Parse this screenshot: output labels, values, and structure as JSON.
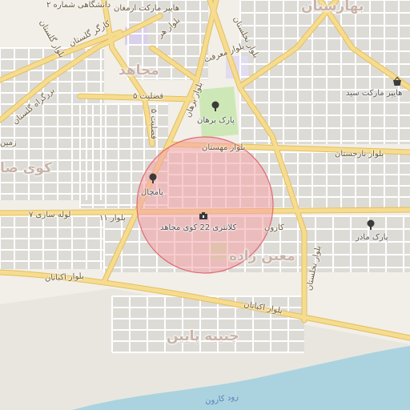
{
  "colors": {
    "background": "#f2efe9",
    "block": "#dddbd6",
    "block_outline": "#ffffff",
    "major_road": "#f6dc8f",
    "major_road_casing": "#e3bf61",
    "minor_road": "#ffffff",
    "park": "#cde8b6",
    "water": "#aad3df",
    "sand": "#e9e6e0",
    "highlight_circle_fill": "#f4a3a8",
    "highlight_circle_stroke": "#e06a73"
  },
  "highlight_circle": {
    "shown": true
  },
  "districts": {
    "baharestan": "بهارستان",
    "mojahed": "مجاهد",
    "koye_sa": "کوی صا",
    "moin_zadeh": "معین زاده",
    "chenibeh_paeen": "چنیبه پایین"
  },
  "roads": {
    "golestan_university": "دانشگاهی شماره ۲",
    "hyper_armaghan": "هایپر مارکت ارمغان",
    "golestan_tollgate": "کارگر گلستان",
    "bolvar_golestan": "بلوار گلستان",
    "bolvar_hor": "بلوار هر",
    "bolvar_marafat": "بلوار معرفت",
    "bolvar_nakhlestan_top": "بلوار نخلستان",
    "bolvar_nakhlestan_bottom": "بلوار نخلستان",
    "zargaregolestan": "بزرگراه گلستان",
    "fazilat5": "فضلیت ۵",
    "bolvar_borhan": "بلوار برهان",
    "bolvar_mahestan": "بلوار مهستان",
    "bolvar_narjestan": "بلوار نارجستان",
    "loleh_sazi": "لوله سازی ۷",
    "bolvar11": "بلوار ۱۱",
    "karun": "کارون",
    "bolvar_ekbatan_left": "بلوار اکباتان",
    "bolvar_ekbatan_right": "بلوار اکباتان",
    "zamin": "زمین",
    "karun_river": "رود کارون"
  },
  "pois": {
    "park_borhan": "پارک برهان",
    "hypermarket_saeed": "هایپر مارکت سید",
    "pamchal": "پامچال",
    "kalantari": "کلانتری 22 کوی مجاهد",
    "park_madar": "پارک مادر"
  },
  "icons": {
    "park_borhan": "tree-icon",
    "park_madar": "tree-icon",
    "pamchal": "tree-icon",
    "hypermarket": "shopping-basket-icon",
    "kalantari": "police-icon"
  }
}
